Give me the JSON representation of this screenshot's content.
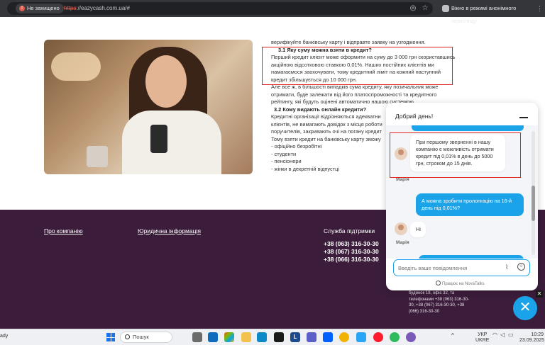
{
  "browser": {
    "security_label": "Не захищено",
    "url_scheme": "https",
    "url_rest": "://eazycash.com.ua/#",
    "incognito_label": "Вікно в режимі анонімного перегляду"
  },
  "article": {
    "line_top": "верифікуйте банківську карту і відправте заявку на узгодження.",
    "h1": "3.1 Яку суму можна взяти в кредит?",
    "p1": [
      "Перший кредит клієнт може оформити на суму до 3 000 грн скориставшись",
      "акційною відсотковою ставкою 0,01%. Наших постійних клієнтів ми",
      "намагаємося заохочувати, тому кредитний ліміт на кожний наступний",
      "кредит збільшується до 10 000 грн."
    ],
    "p2": [
      "Але все ж, в більшості випадків сума кредиту, яку позичальник може",
      "отримати, буде залежати від його платоспроможності та кредитного",
      "рейтингу, які будуть оцінені автоматично нашою системою."
    ],
    "h2": "3.2 Кому видають онлайн кредити?",
    "p3": [
      "Кредитні організації відрізняються адекватни",
      "клієнтів, не вимагають довідок з місця роботи",
      "поручителів, закривають очі на погану кредит",
      "Тому взяти кредит на банківську карту зможу"
    ],
    "list": [
      "- офіційно безробітні",
      "- студенти",
      "- пенсіонери",
      "- жінки в декретній відпустці"
    ]
  },
  "footer": {
    "about_link": "Про компанію",
    "legal_link": "Юридична інформація",
    "support_title": "Служба підтримки",
    "phones": [
      "+38 (063) 316-30-30",
      "+38 (067) 316-30-30",
      "+38 (066) 316-30-30"
    ],
    "address_lines": [
      "будинок 18, офіс 32, та",
      "телефонами +38 (063) 316-30-",
      "30, +38 (067) 316-30-30, +38",
      "(066) 316-30-30"
    ]
  },
  "chat": {
    "title": "Добрий день!",
    "msg_agent_1": [
      "При першому зверненні в нашу",
      "компанію є можливість отримати",
      "кредит під 0,01% в день до 5000",
      "грн, строком до 15 днів."
    ],
    "agent_name": "Марія",
    "msg_user": [
      "А можна зробити пролонгацію на 16-й",
      "день під 0,01%?"
    ],
    "msg_agent_2": "Hi",
    "input_placeholder": "Введіть ваше повідомлення",
    "powered_by": "Працює на NovaTalks"
  },
  "taskbar": {
    "left_text": "ady",
    "search_label": "Пошук",
    "lang_line1": "УКР",
    "lang_line2": "UKRE",
    "time": "10:29",
    "date": "23.09.2025"
  },
  "colors": {
    "footer_bg": "#3b1d3b",
    "chat_accent": "#1aa3e8",
    "highlight_red": "#e0211f"
  }
}
